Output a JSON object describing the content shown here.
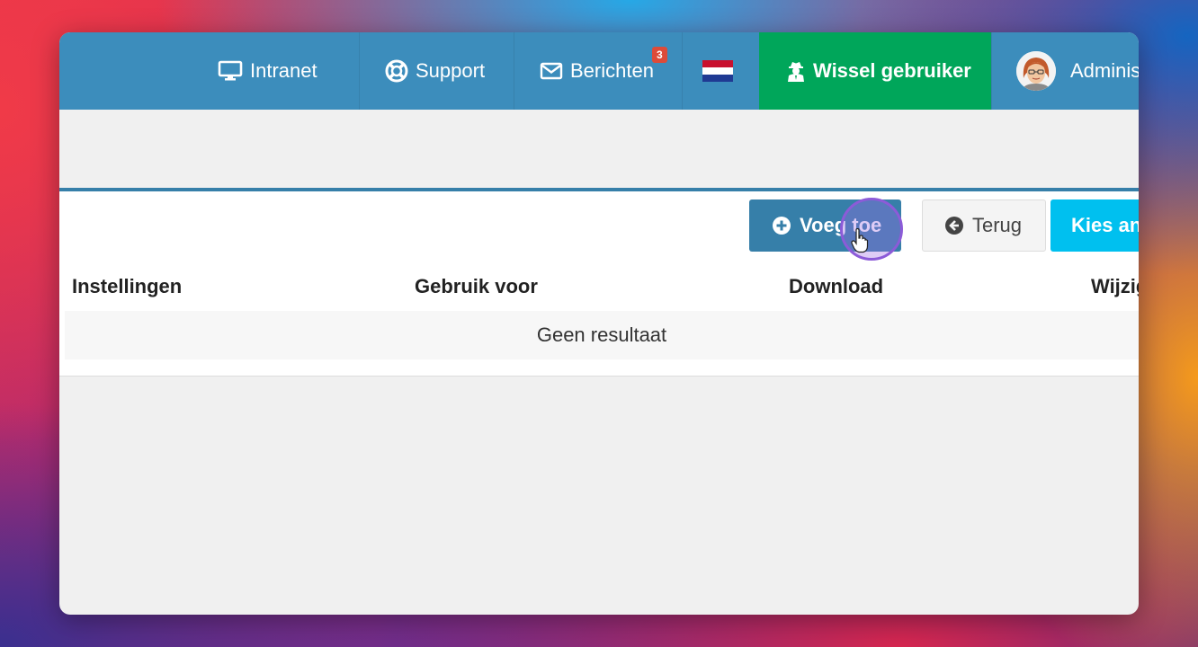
{
  "topbar": {
    "intranet": "Intranet",
    "support": "Support",
    "berichten": "Berichten",
    "berichten_badge": "3",
    "switch_user": "Wissel gebruiker",
    "user_name": "Administrator"
  },
  "toolbar": {
    "add_label": "Voeg toe",
    "back_label": "Terug",
    "choose_label": "Kies andere"
  },
  "table": {
    "columns": [
      "Instellingen",
      "Gebruik voor",
      "Download",
      "Wijzigen"
    ],
    "empty_text": "Geen resultaat"
  },
  "colors": {
    "topbar": "#3c8dbc",
    "switch_user": "#00a65a",
    "primary_button": "#367fa9",
    "info_button": "#00c0ef",
    "badge": "#dd4b39"
  }
}
